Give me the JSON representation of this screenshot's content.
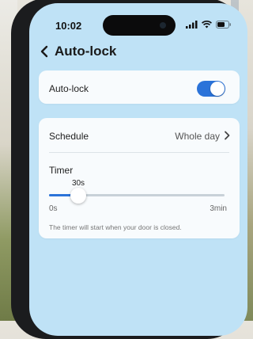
{
  "status_bar": {
    "time": "10:02",
    "icons": [
      "cellular-signal-icon",
      "wifi-icon",
      "battery-icon"
    ]
  },
  "header": {
    "back_icon": "chevron-left-icon",
    "title": "Auto-lock"
  },
  "autolock": {
    "label": "Auto-lock",
    "enabled": true
  },
  "schedule": {
    "label": "Schedule",
    "value": "Whole day",
    "icon": "chevron-right-icon"
  },
  "timer": {
    "label": "Timer",
    "value_label": "30s",
    "min_label": "0s",
    "max_label": "3min",
    "min_seconds": 0,
    "max_seconds": 180,
    "current_seconds": 30,
    "hint": "The timer will start when your door is closed."
  },
  "colors": {
    "accent": "#2b73d9",
    "screen_background": "#bfe2f6",
    "card_background": "#f8fbfd"
  }
}
